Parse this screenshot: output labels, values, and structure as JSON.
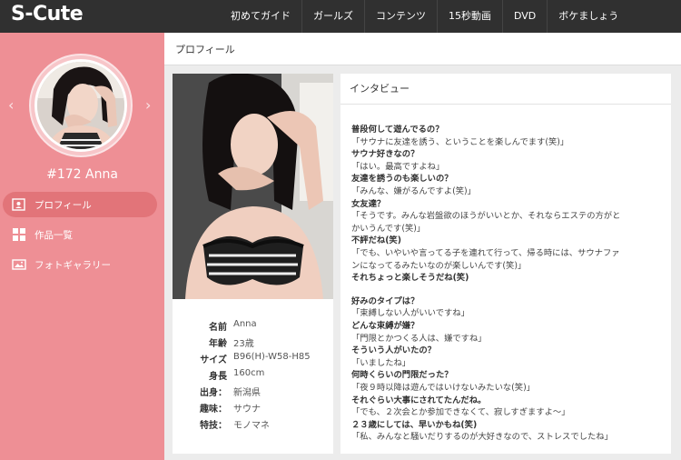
{
  "header": {
    "logo": "S-Cute",
    "nav": [
      "初めてガイド",
      "ガールズ",
      "コンテンツ",
      "15秒動画",
      "DVD",
      "ボケましょう"
    ]
  },
  "sidebar": {
    "prev": "‹",
    "next": "›",
    "name": "#172 Anna",
    "menu": [
      "プロフィール",
      "作品一覧",
      "フォトギャラリー"
    ]
  },
  "main": {
    "title": "プロフィール"
  },
  "profile": {
    "fields": [
      {
        "label": "名前",
        "value": "Anna"
      },
      {
        "label": "年齢",
        "value": "23歳"
      },
      {
        "label": "サイズ",
        "value": "B96(H)-W58-H85"
      },
      {
        "label": "身長",
        "value": "160cm"
      },
      {
        "label": "出身：",
        "value": "新潟県"
      },
      {
        "label": "趣味：",
        "value": "サウナ"
      },
      {
        "label": "特技：",
        "value": "モノマネ"
      }
    ]
  },
  "interview": {
    "title": "インタビュー",
    "lines": [
      {
        "t": "q",
        "text": "普段何して遊んでるの？"
      },
      {
        "t": "a",
        "text": "「サウナに友達を誘う、ということを楽しんでます(笑)」"
      },
      {
        "t": "q",
        "text": "サウナ好きなの？"
      },
      {
        "t": "a",
        "text": "「はい。最高ですよね」"
      },
      {
        "t": "q",
        "text": "友達を誘うのも楽しいの？"
      },
      {
        "t": "a",
        "text": "「みんな、嫌がるんですよ(笑)」"
      },
      {
        "t": "q",
        "text": "女友達？"
      },
      {
        "t": "a",
        "text": "「そうです。みんな岩盤欲のほうがいいとか、それならエステの方がと"
      },
      {
        "t": "a",
        "text": "かいうんです(笑)」"
      },
      {
        "t": "q",
        "text": "不評だね(笑)"
      },
      {
        "t": "a",
        "text": "「でも、いやいや言ってる子を連れて行って、帰る時には、サウナファ"
      },
      {
        "t": "a",
        "text": "ンになってるみたいなのが楽しいんです(笑)」"
      },
      {
        "t": "q",
        "text": "それちょっと楽しそうだね(笑)"
      },
      {
        "t": "gap",
        "text": ""
      },
      {
        "t": "q",
        "text": "好みのタイプは？"
      },
      {
        "t": "a",
        "text": "「束縛しない人がいいですね」"
      },
      {
        "t": "q",
        "text": "どんな束縛が嫌？"
      },
      {
        "t": "a",
        "text": "「門限とかつくる人は、嫌ですね」"
      },
      {
        "t": "q",
        "text": "そういう人がいたの？"
      },
      {
        "t": "a",
        "text": "「いましたね」"
      },
      {
        "t": "q",
        "text": "何時くらいの門限だった？"
      },
      {
        "t": "a",
        "text": "「夜９時以降は遊んではいけないみたいな(笑)」"
      },
      {
        "t": "q",
        "text": "それぐらい大事にされてたんだね。"
      },
      {
        "t": "a",
        "text": "「でも、２次会とか参加できなくて、寂しすぎますよ～」"
      },
      {
        "t": "q",
        "text": "２３歳にしては、早いかもね(笑)"
      },
      {
        "t": "a",
        "text": "「私、みんなと騒いだりするのが大好きなので、ストレスでしたね」"
      }
    ]
  },
  "colors": {
    "topbar": "#303030",
    "sidebar": "#ee8f95",
    "active_menu": "#e27479",
    "background": "#ececec"
  },
  "icons": [
    "profile-card-icon",
    "grid-icon",
    "photo-icon"
  ]
}
